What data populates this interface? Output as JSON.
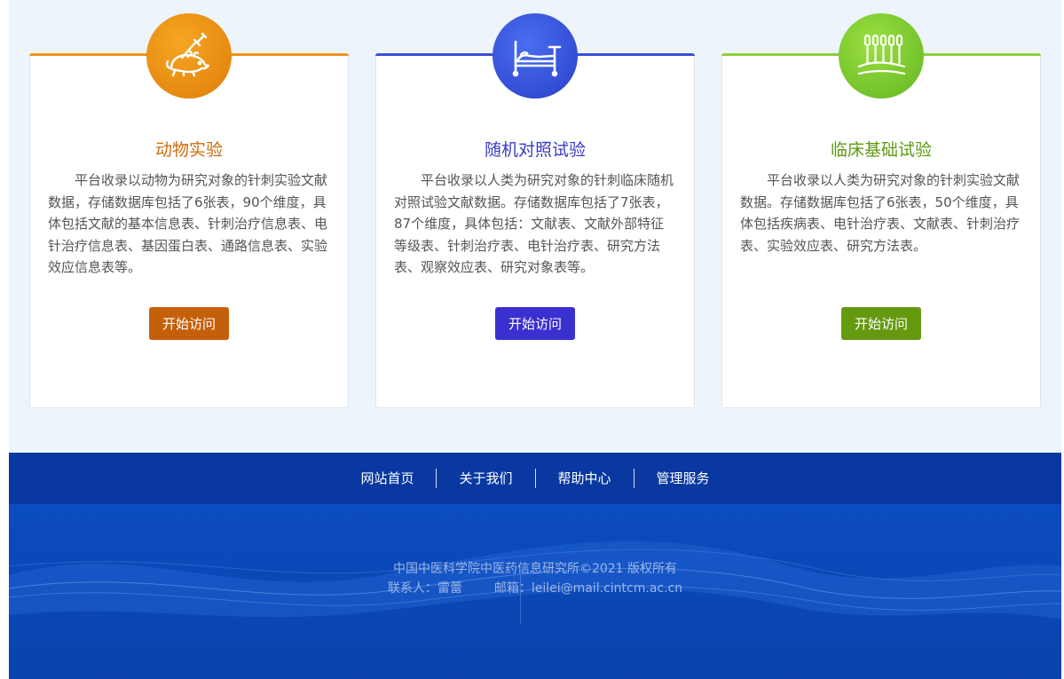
{
  "cards": [
    {
      "icon": "mouse-syringe-icon",
      "title": "动物实验",
      "description": "平台收录以动物为研究对象的针刺实验文献数据，存储数据库包括了6张表，90个维度，具体包括文献的基本信息表、针刺治疗信息表、电针治疗信息表、基因蛋白表、通路信息表、实验效应信息表等。",
      "button": "开始访问",
      "accent": "#f0921e"
    },
    {
      "icon": "hospital-bed-icon",
      "title": "随机对照试验",
      "description": "平台收录以人类为研究对象的针刺临床随机对照试验文献数据。存储数据库包括了7张表，87个维度，具体包括：文献表、文献外部特征等级表、针刺治疗表、电针治疗表、研究方法表、观察效应表、研究对象表等。",
      "button": "开始访问",
      "accent": "#3b4fd8"
    },
    {
      "icon": "acupuncture-needles-icon",
      "title": "临床基础试验",
      "description": "平台收录以人类为研究对象的针刺实验文献数据。存储数据库包括了6张表，50个维度，具体包括疾病表、电针治疗表、文献表、针刺治疗表、实验效应表、研究方法表。",
      "button": "开始访问",
      "accent": "#8ccf3a"
    }
  ],
  "footer": {
    "nav": [
      "网站首页",
      "关于我们",
      "帮助中心",
      "管理服务"
    ],
    "copyright": "中国中医科学院中医药信息研究所©2021 版权所有",
    "contact": "联系人：雷蕾",
    "email": "邮箱：leilei@mail.cintcm.ac.cn"
  }
}
